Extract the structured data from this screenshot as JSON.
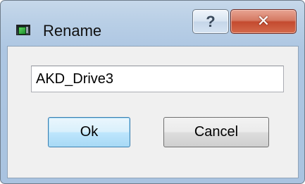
{
  "window": {
    "title": "Rename",
    "icon": "app-icon",
    "help_label": "?",
    "close_label": "✕"
  },
  "form": {
    "name_value": "AKD_Drive3"
  },
  "buttons": {
    "ok_label": "Ok",
    "cancel_label": "Cancel"
  }
}
